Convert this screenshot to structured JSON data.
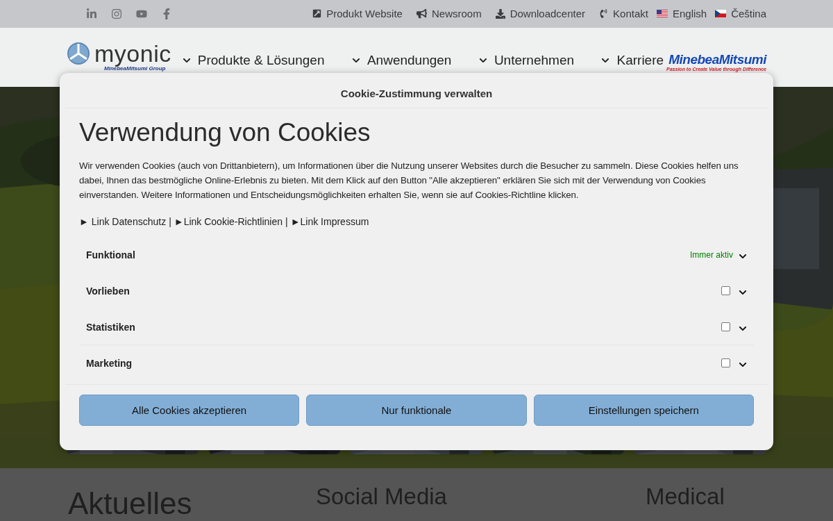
{
  "top_bar": {
    "links": [
      {
        "label": "Produkt Website",
        "kind": "external"
      },
      {
        "label": "Newsroom",
        "kind": "megaphone"
      },
      {
        "label": "Downloadcenter",
        "kind": "download"
      },
      {
        "label": "Kontakt",
        "kind": "phone"
      },
      {
        "label": "English",
        "kind": "flag-us"
      },
      {
        "label": "Čeština",
        "kind": "flag-cz"
      }
    ]
  },
  "header": {
    "logo": {
      "name": "myonic",
      "group": "MinebeaMitsumi Group"
    },
    "nav": [
      {
        "label": "Produkte & Lösungen"
      },
      {
        "label": "Anwendungen"
      },
      {
        "label": "Unternehmen"
      },
      {
        "label": "Karriere"
      }
    ],
    "brand": {
      "name": "MinebeaMitsumi",
      "slogan": "Passion to Create Value through Difference"
    }
  },
  "sections": [
    {
      "title": "Aktuelles"
    },
    {
      "title": "Social Media"
    },
    {
      "title": "Medical"
    }
  ],
  "cookie_dialog": {
    "title": "Cookie-Zustimmung verwalten",
    "heading": "Verwendung von Cookies",
    "text": "Wir verwenden Cookies (auch von Drittanbietern), um Informationen über die Nutzung unserer Websites durch die Besucher zu sammeln. Diese Cookies helfen uns dabei, Ihnen das bestmögliche Online-Erlebnis zu bieten. Mit dem Klick auf den Button \"Alle akzeptieren\" erklären Sie sich mit der Verwendung von Cookies einverstanden. Weitere Informationen und Entscheidungsmöglichkeiten erhalten Sie, wenn sie auf Cookies-Richtline klicken.",
    "links": [
      {
        "label": "► Link Datenschutz"
      },
      {
        "label": "►Link Cookie-Richtlinien"
      },
      {
        "label": "►Link Impressum"
      }
    ],
    "separator": "|",
    "categories": [
      {
        "label": "Funktional",
        "kind": "always",
        "status": "Immer aktiv"
      },
      {
        "label": "Vorlieben",
        "kind": "toggle",
        "checked": false
      },
      {
        "label": "Statistiken",
        "kind": "toggle",
        "checked": false
      },
      {
        "label": "Marketing",
        "kind": "toggle",
        "checked": false
      }
    ],
    "buttons": [
      {
        "label": "Alle Cookies akzeptieren"
      },
      {
        "label": "Nur funktionale"
      },
      {
        "label": "Einstellungen speichern"
      }
    ]
  }
}
